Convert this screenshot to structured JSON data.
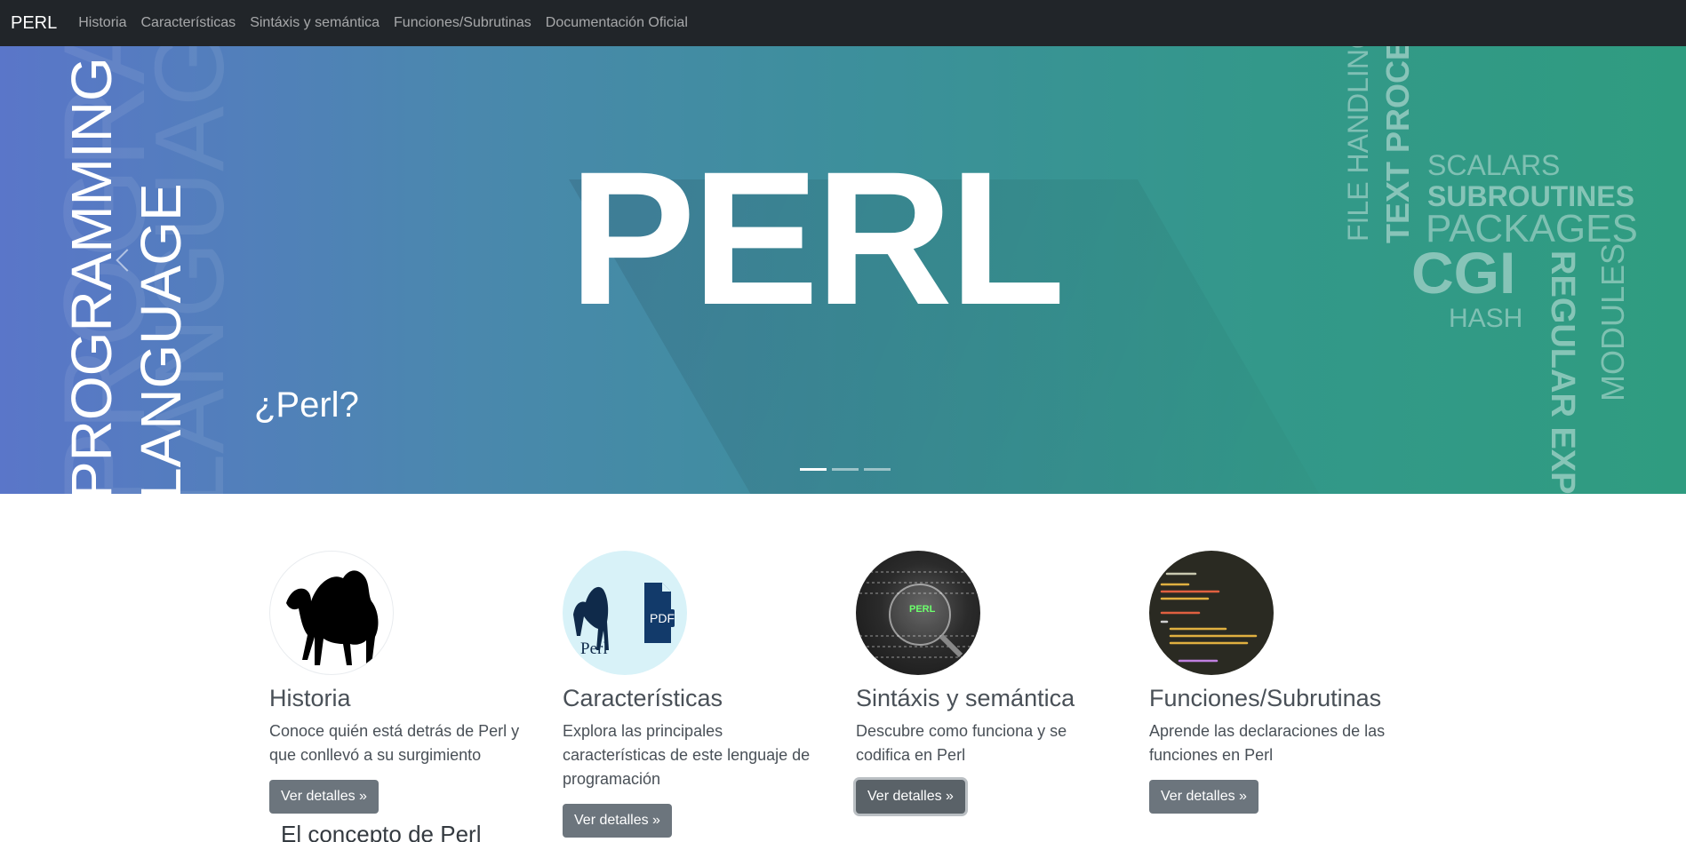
{
  "nav": {
    "brand": "PERL",
    "links": [
      "Historia",
      "Características",
      "Sintáxis y semántica",
      "Funciones/Subrutinas",
      "Documentación Oficial"
    ]
  },
  "carousel": {
    "slide_title": "PERL",
    "caption": "¿Perl?",
    "left_words": [
      "PROGRAMMING",
      "LANGUAGE"
    ],
    "right_words": {
      "file_handling": "FILE HANDLING",
      "text_process": "TEXT PROCESS",
      "scalars": "SCALARS",
      "subroutines": "SUBROUTINES",
      "packages": "PACKAGES",
      "cgi": "CGI",
      "hash": "HASH",
      "regular_expr": "REGULAR EXPRE",
      "modules": "MODULES"
    },
    "active_slide": 1,
    "slide_count": 3
  },
  "features": [
    {
      "title": "Historia",
      "text": "Conoce quién está detrás de Perl y que conllevó a su surgimiento",
      "button": "Ver detalles »",
      "icon": "camel-icon"
    },
    {
      "title": "Características",
      "text": "Explora las principales características de este lenguaje de programación",
      "button": "Ver detalles »",
      "icon": "perl-pdf-icon"
    },
    {
      "title": "Sintáxis y semántica",
      "text": "Descubre como funciona y se codifica en Perl",
      "button": "Ver detalles »",
      "icon": "binary-magnifier-icon"
    },
    {
      "title": "Funciones/Subrutinas",
      "text": "Aprende las declaraciones de las funciones en Perl",
      "button": "Ver detalles »",
      "icon": "code-screen-icon"
    }
  ],
  "thumb3_label": "PERL",
  "thumb2_labels": {
    "perl": "Perl",
    "pdf": "PDF"
  },
  "section_title": "El concepto de Perl",
  "colors": {
    "navbar": "#212529",
    "button": "#6c757d",
    "gradient_left": "#5a76c9",
    "gradient_right": "#2f9c80"
  }
}
